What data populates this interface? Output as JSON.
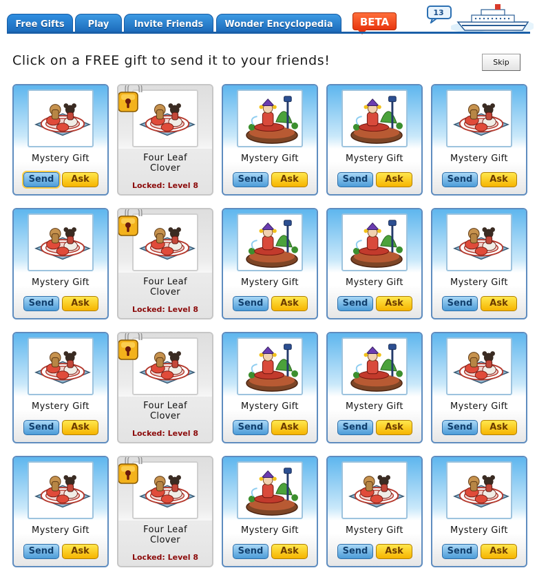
{
  "nav": {
    "tabs": [
      "Free Gifts",
      "Play",
      "Invite Friends",
      "Wonder Encyclopedia"
    ],
    "beta_label": "BETA",
    "message_count": "13"
  },
  "header": {
    "instruction": "Click on a FREE gift to send it to your friends!",
    "skip_label": "Skip"
  },
  "gift_names": {
    "mystery": "Mystery Gift",
    "clover_line1": "Four Leaf",
    "clover_line2": "Clover"
  },
  "labels": {
    "send": "Send",
    "ask": "Ask",
    "locked": "Locked: Level 8"
  },
  "gifts": [
    {
      "name": "Mystery Gift",
      "art": "teacups",
      "locked": false
    },
    {
      "name": "Four Leaf Clover",
      "art": "teacups",
      "locked": true
    },
    {
      "name": "Mystery Gift",
      "art": "jester-fountain",
      "locked": false
    },
    {
      "name": "Mystery Gift",
      "art": "jester-fountain",
      "locked": false
    },
    {
      "name": "Mystery Gift",
      "art": "teacups",
      "locked": false
    },
    {
      "name": "Mystery Gift",
      "art": "teacups",
      "locked": false
    },
    {
      "name": "Four Leaf Clover",
      "art": "teacups",
      "locked": true
    },
    {
      "name": "Mystery Gift",
      "art": "jester-fountain",
      "locked": false
    },
    {
      "name": "Mystery Gift",
      "art": "jester-fountain",
      "locked": false
    },
    {
      "name": "Mystery Gift",
      "art": "teacups",
      "locked": false
    },
    {
      "name": "Mystery Gift",
      "art": "teacups",
      "locked": false
    },
    {
      "name": "Four Leaf Clover",
      "art": "teacups",
      "locked": true
    },
    {
      "name": "Mystery Gift",
      "art": "jester-fountain",
      "locked": false
    },
    {
      "name": "Mystery Gift",
      "art": "jester-fountain",
      "locked": false
    },
    {
      "name": "Mystery Gift",
      "art": "teacups",
      "locked": false
    },
    {
      "name": "Mystery Gift",
      "art": "teacups",
      "locked": false
    },
    {
      "name": "Four Leaf Clover",
      "art": "teacups",
      "locked": true
    },
    {
      "name": "Mystery Gift",
      "art": "jester-fountain",
      "locked": false
    },
    {
      "name": "Mystery Gift",
      "art": "teacups",
      "locked": false
    },
    {
      "name": "Mystery Gift",
      "art": "teacups",
      "locked": false
    }
  ],
  "colors": {
    "tab_blue": "#1a68b8",
    "send_blue": "#4c9cd8",
    "ask_yellow": "#f6b400",
    "locked_red": "#8b0a0a"
  }
}
